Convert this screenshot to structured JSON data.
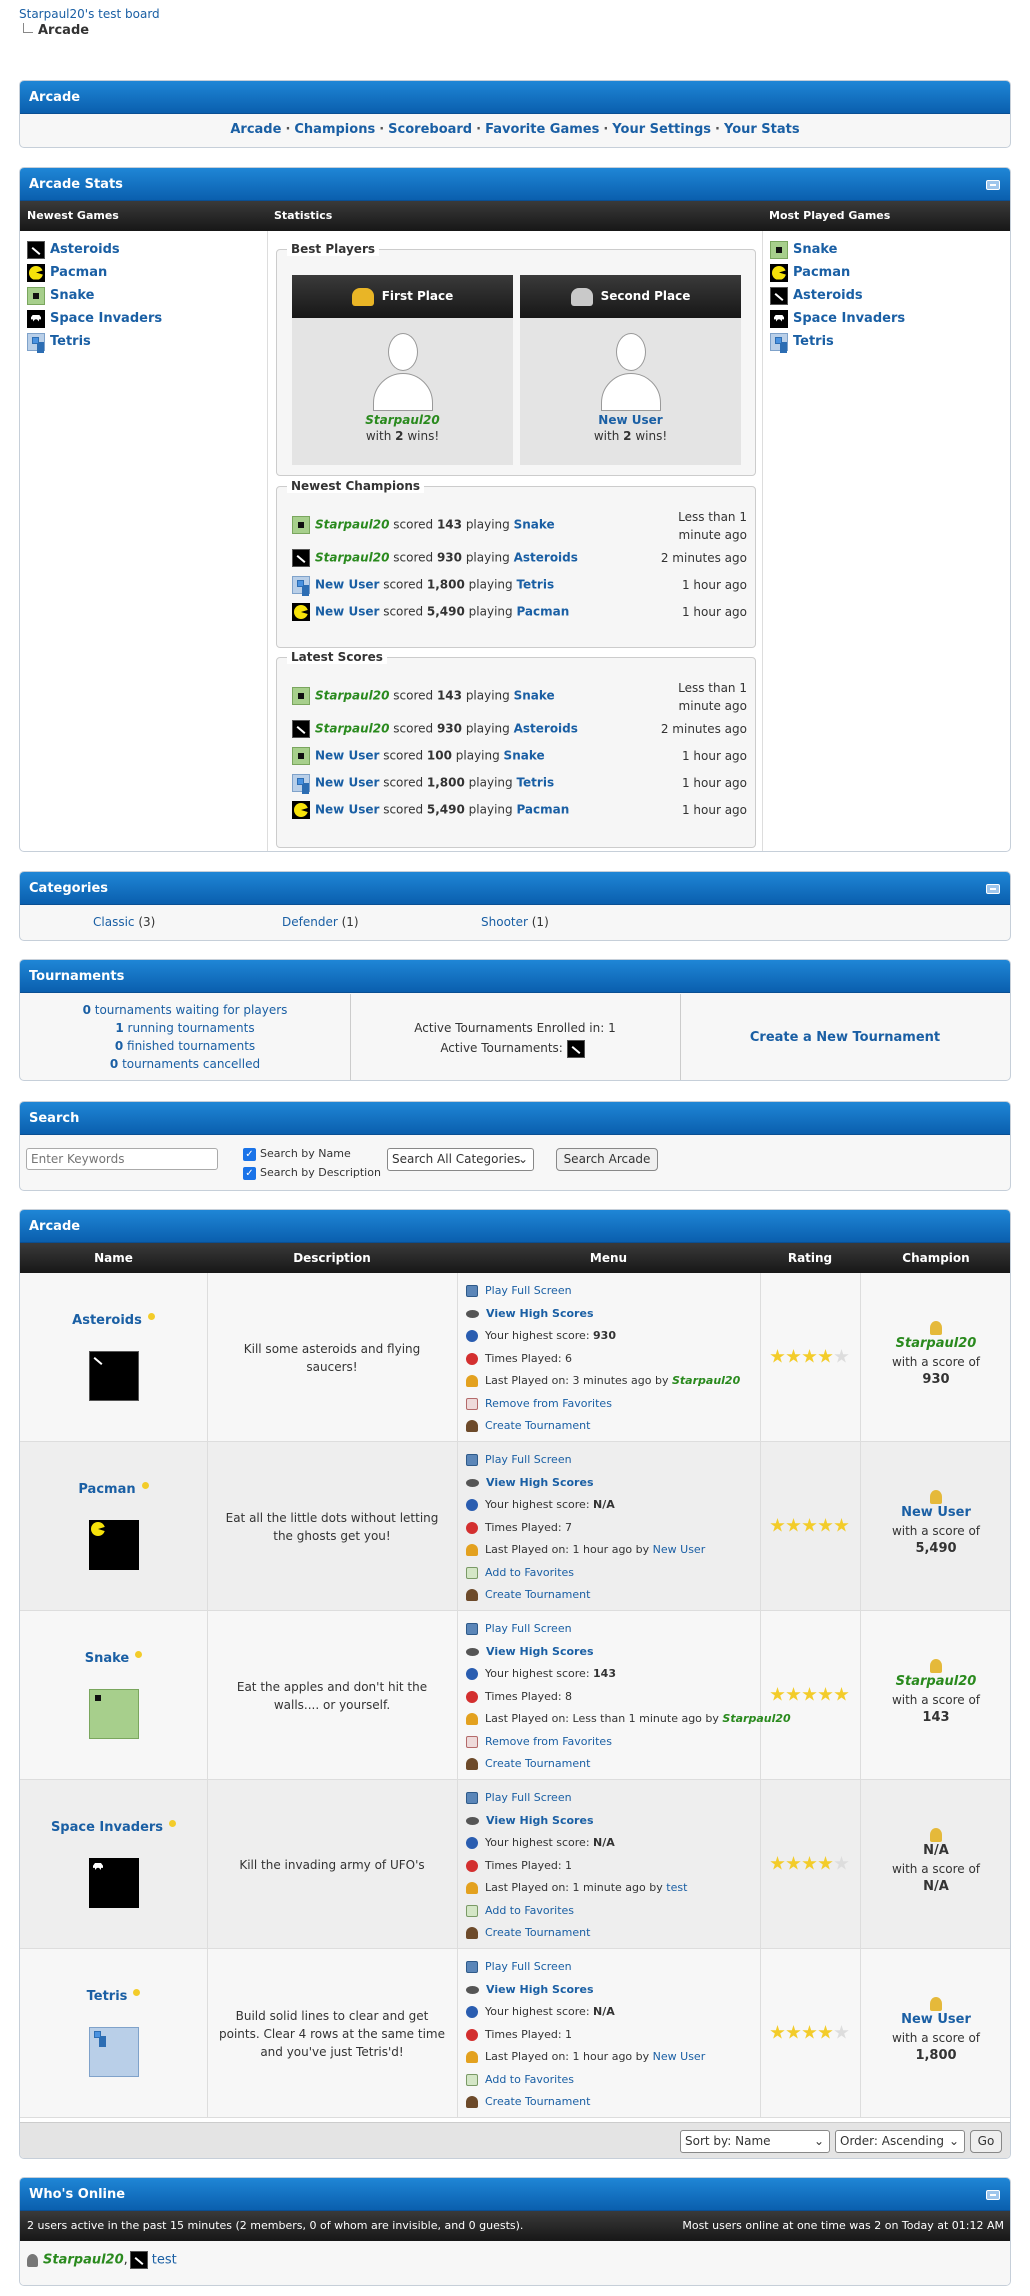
{
  "breadcrumb": {
    "board": "Starpaul20's test board",
    "current": "Arcade"
  },
  "nav_panel": {
    "title": "Arcade",
    "links": [
      "Arcade",
      "Champions",
      "Scoreboard",
      "Favorite Games",
      "Your Settings",
      "Your Stats"
    ]
  },
  "stats_panel": {
    "title": "Arcade Stats",
    "col_newest": "Newest Games",
    "col_statistics": "Statistics",
    "col_most_played": "Most Played Games",
    "newest_games": [
      "Asteroids",
      "Pacman",
      "Snake",
      "Space Invaders",
      "Tetris"
    ],
    "most_played": [
      "Snake",
      "Pacman",
      "Asteroids",
      "Space Invaders",
      "Tetris"
    ],
    "best_players_legend": "Best Players",
    "first_place": {
      "label": "First Place",
      "name": "Starpaul20",
      "with": "with",
      "wins": "2",
      "wins_suffix": "wins!"
    },
    "second_place": {
      "label": "Second Place",
      "name": "New User",
      "with": "with",
      "wins": "2",
      "wins_suffix": "wins!"
    },
    "newest_champions_legend": "Newest Champions",
    "latest_scores_legend": "Latest Scores",
    "scored_word": "scored",
    "playing_word": "playing",
    "newest_champions": [
      {
        "user": "Starpaul20",
        "score": "143",
        "game": "Snake",
        "time": "Less than 1 minute ago",
        "icon": "snake"
      },
      {
        "user": "Starpaul20",
        "score": "930",
        "game": "Asteroids",
        "time": "2 minutes ago",
        "icon": "asteroids"
      },
      {
        "user": "New User",
        "score": "1,800",
        "game": "Tetris",
        "time": "1 hour ago",
        "icon": "tetris"
      },
      {
        "user": "New User",
        "score": "5,490",
        "game": "Pacman",
        "time": "1 hour ago",
        "icon": "pacman"
      }
    ],
    "latest_scores": [
      {
        "user": "Starpaul20",
        "score": "143",
        "game": "Snake",
        "time": "Less than 1 minute ago",
        "icon": "snake"
      },
      {
        "user": "Starpaul20",
        "score": "930",
        "game": "Asteroids",
        "time": "2 minutes ago",
        "icon": "asteroids"
      },
      {
        "user": "New User",
        "score": "100",
        "game": "Snake",
        "time": "1 hour ago",
        "icon": "snake"
      },
      {
        "user": "New User",
        "score": "1,800",
        "game": "Tetris",
        "time": "1 hour ago",
        "icon": "tetris"
      },
      {
        "user": "New User",
        "score": "5,490",
        "game": "Pacman",
        "time": "1 hour ago",
        "icon": "pacman"
      }
    ]
  },
  "categories_panel": {
    "title": "Categories",
    "items": [
      {
        "name": "Classic",
        "count": "(3)"
      },
      {
        "name": "Defender",
        "count": "(1)"
      },
      {
        "name": "Shooter",
        "count": "(1)"
      }
    ]
  },
  "tournaments_panel": {
    "title": "Tournaments",
    "stats": [
      {
        "num": "0",
        "text": "tournaments waiting for players"
      },
      {
        "num": "1",
        "text": "running tournaments"
      },
      {
        "num": "0",
        "text": "finished tournaments"
      },
      {
        "num": "0",
        "text": "tournaments cancelled"
      }
    ],
    "enrolled": "Active Tournaments Enrolled in: 1",
    "active_label": "Active Tournaments:",
    "create_link": "Create a New Tournament"
  },
  "search_panel": {
    "title": "Search",
    "keyword_placeholder": "Enter Keywords",
    "by_name": "Search by Name",
    "by_description": "Search by Description",
    "category_select": "Search All Categories",
    "button": "Search Arcade"
  },
  "games_panel": {
    "title": "Arcade",
    "headers": [
      "Name",
      "Description",
      "Menu",
      "Rating",
      "Champion"
    ],
    "menu_labels": {
      "play": "Play Full Screen",
      "high_scores": "View High Scores",
      "your_highest": "Your highest score:",
      "times_played": "Times Played:",
      "last_played": "Last Played on:",
      "by": "by",
      "create": "Create Tournament"
    },
    "champ_with": "with a score of",
    "games": [
      {
        "name": "Asteroids",
        "icon": "asteroids",
        "desc": "Kill some asteroids and flying saucers!",
        "highest": "930",
        "times": "6",
        "last": "3 minutes ago",
        "last_by": "Starpaul20",
        "last_by_style": "green",
        "fav_action": "Remove from Favorites",
        "fav_type": "rem",
        "rating": 4,
        "champ": "Starpaul20",
        "champ_style": "green",
        "champ_score": "930"
      },
      {
        "name": "Pacman",
        "icon": "pacman",
        "desc": "Eat all the little dots without letting the ghosts get you!",
        "highest": "N/A",
        "times": "7",
        "last": "1 hour ago",
        "last_by": "New User",
        "last_by_style": "blue",
        "fav_action": "Add to Favorites",
        "fav_type": "fav",
        "rating": 5,
        "champ": "New User",
        "champ_style": "blue",
        "champ_score": "5,490"
      },
      {
        "name": "Snake",
        "icon": "snake",
        "desc": "Eat the apples and don't hit the walls.... or yourself.",
        "highest": "143",
        "times": "8",
        "last": "Less than 1 minute ago",
        "last_by": "Starpaul20",
        "last_by_style": "green",
        "fav_action": "Remove from Favorites",
        "fav_type": "rem",
        "rating": 5,
        "champ": "Starpaul20",
        "champ_style": "green",
        "champ_score": "143"
      },
      {
        "name": "Space Invaders",
        "icon": "spaceinv",
        "desc": "Kill the invading army of UFO's",
        "highest": "N/A",
        "times": "1",
        "last": "1 minute ago",
        "last_by": "test",
        "last_by_style": "plain",
        "fav_action": "Add to Favorites",
        "fav_type": "fav",
        "rating": 4,
        "champ": "N/A",
        "champ_style": "plain",
        "champ_score": "N/A"
      },
      {
        "name": "Tetris",
        "icon": "tetris",
        "desc": "Build solid lines to clear and get points. Clear 4 rows at the same time and you've just Tetris'd!",
        "highest": "N/A",
        "times": "1",
        "last": "1 hour ago",
        "last_by": "New User",
        "last_by_style": "blue",
        "fav_action": "Add to Favorites",
        "fav_type": "fav",
        "rating": 4,
        "champ": "New User",
        "champ_style": "blue",
        "champ_score": "1,800"
      }
    ],
    "sort_select": "Sort by: Name",
    "order_select": "Order: Ascending",
    "go_button": "Go"
  },
  "online_panel": {
    "title": "Who's Online",
    "summary": "2 users active in the past 15 minutes (2 members, 0 of whom are invisible, and 0 guests).",
    "record": "Most users online at one time was 2 on Today at 01:12 AM",
    "users": [
      {
        "name": "Starpaul20",
        "style": "green",
        "sep": ","
      },
      {
        "name": "test",
        "style": "plain",
        "sep": ""
      }
    ]
  },
  "colors": {
    "header_blue": "#0a5fae",
    "link_blue": "#1a5fa4",
    "green_user": "#2a8a1e",
    "star": "#f3cc2a"
  }
}
